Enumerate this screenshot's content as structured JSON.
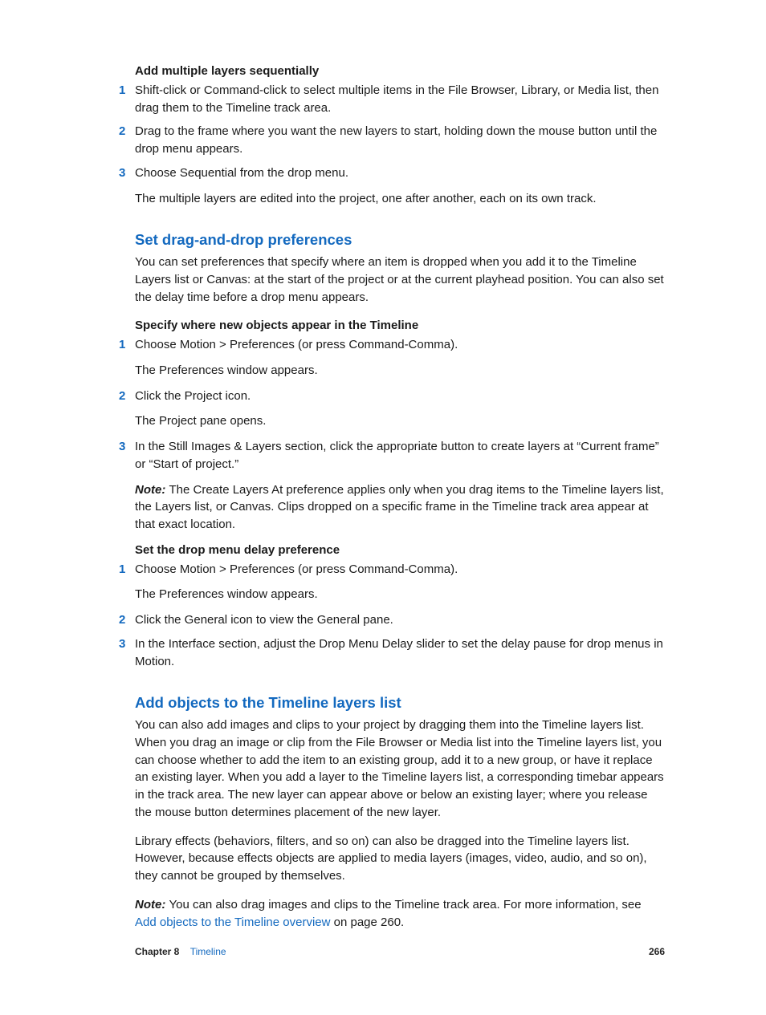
{
  "sec1": {
    "heading": "Add multiple layers sequentially",
    "step1": "Shift-click or Command-click to select multiple items in the File Browser, Library, or Media list, then drag them to the Timeline track area.",
    "step2": "Drag to the frame where you want the new layers to start, holding down the mouse button until the drop menu appears.",
    "step3": "Choose Sequential from the drop menu.",
    "step3_after": "The multiple layers are edited into the project, one after another, each on its own track."
  },
  "sec2": {
    "title": "Set drag-and-drop preferences",
    "intro": "You can set preferences that specify where an item is dropped when you add it to the Timeline Layers list or Canvas: at the start of the project or at the current playhead position. You can also set the delay time before a drop menu appears.",
    "sub1_heading": "Specify where new objects appear in the Timeline",
    "sub1_step1": "Choose Motion > Preferences (or press Command-Comma).",
    "sub1_step1_after": "The Preferences window appears.",
    "sub1_step2": "Click the Project icon.",
    "sub1_step2_after": "The Project pane opens.",
    "sub1_step3": "In the Still Images & Layers section, click the appropriate button to create layers at “Current frame” or “Start of project.”",
    "sub1_note_label": "Note:  ",
    "sub1_note": "The Create Layers At preference applies only when you drag items to the Timeline layers list, the Layers list, or Canvas. Clips dropped on a specific frame in the Timeline track area appear at that exact location.",
    "sub2_heading": "Set the drop menu delay preference",
    "sub2_step1": "Choose Motion > Preferences (or press Command-Comma).",
    "sub2_step1_after": "The Preferences window appears.",
    "sub2_step2": "Click the General icon to view the General pane.",
    "sub2_step3": "In the Interface section, adjust the Drop Menu Delay slider to set the delay pause for drop menus in Motion."
  },
  "sec3": {
    "title": "Add objects to the Timeline layers list",
    "p1": "You can also add images and clips to your project by dragging them into the Timeline layers list. When you drag an image or clip from the File Browser or Media list into the Timeline layers list, you can choose whether to add the item to an existing group, add it to a new group, or have it replace an existing layer. When you add a layer to the Timeline layers list, a corresponding timebar appears in the track area. The new layer can appear above or below an existing layer; where you release the mouse button determines placement of the new layer.",
    "p2": "Library effects (behaviors, filters, and so on) can also be dragged into the Timeline layers list. However, because effects objects are applied to media layers (images, video, audio, and so on), they cannot be grouped by themselves.",
    "note_label": "Note:  ",
    "note_body1": "You can also drag images and clips to the Timeline track area. For more information, see ",
    "note_link": "Add objects to the Timeline overview",
    "note_body2": " on page 260."
  },
  "footer": {
    "chapter_label": "Chapter 8",
    "chapter_name": "Timeline",
    "page": "266"
  },
  "nums": {
    "n1": "1",
    "n2": "2",
    "n3": "3"
  }
}
